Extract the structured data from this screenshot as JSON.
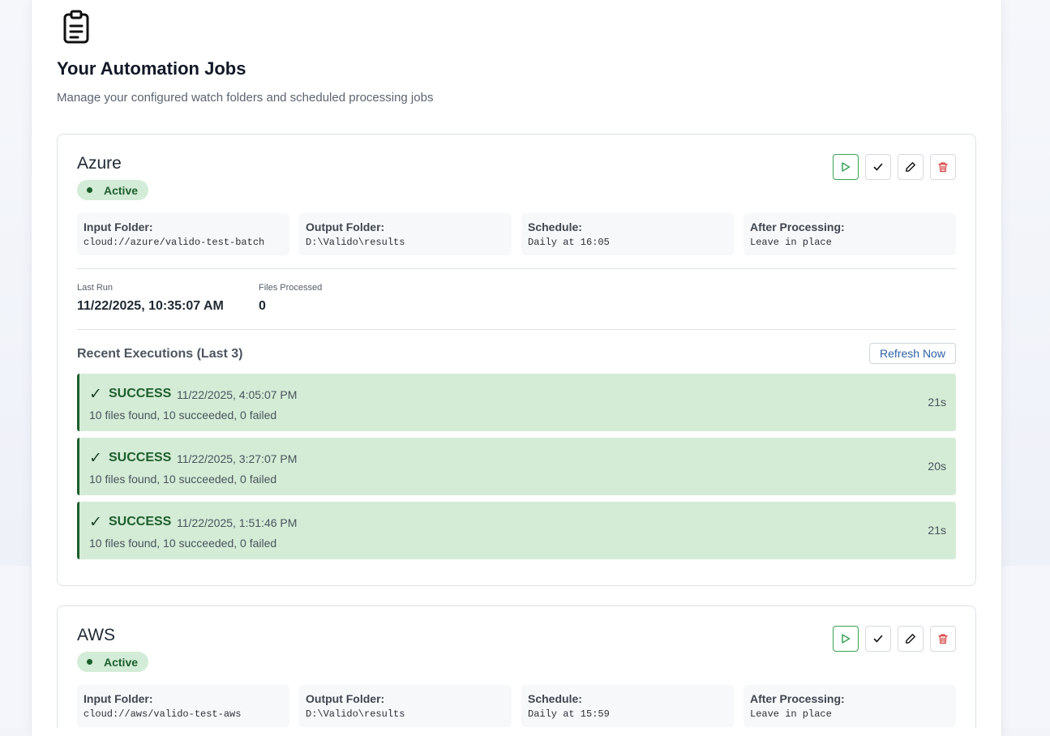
{
  "header": {
    "icon": "clipboard-icon",
    "title": "Your Automation Jobs",
    "subtitle": "Manage your configured watch folders and scheduled processing jobs"
  },
  "actions": {
    "run_icon": "play-icon",
    "validate_icon": "check-icon",
    "edit_icon": "pencil-icon",
    "delete_icon": "trash-icon"
  },
  "colors": {
    "success_bg": "#d4ecd6",
    "success_text": "#1c5e2c",
    "link": "#2d62a8",
    "delete": "#d33a3a",
    "run": "#3aa356"
  },
  "jobs": [
    {
      "name": "Azure",
      "status": "Active",
      "fields": [
        {
          "label": "Input Folder:",
          "value": "cloud://azure/valido-test-batch"
        },
        {
          "label": "Output Folder:",
          "value": "D:\\Valido\\results"
        },
        {
          "label": "Schedule:",
          "value": "Daily at 16:05"
        },
        {
          "label": "After Processing:",
          "value": "Leave in place"
        }
      ],
      "last_run_label": "Last Run",
      "last_run": "11/22/2025, 10:35:07 AM",
      "files_processed_label": "Files Processed",
      "files_processed": "0",
      "recent_title": "Recent Executions (Last 3)",
      "refresh_label": "Refresh Now",
      "executions": [
        {
          "check": "✓",
          "status": "SUCCESS",
          "time": "11/22/2025, 4:05:07 PM",
          "summary": "10 files found, 10 succeeded, 0 failed",
          "duration": "21s"
        },
        {
          "check": "✓",
          "status": "SUCCESS",
          "time": "11/22/2025, 3:27:07 PM",
          "summary": "10 files found, 10 succeeded, 0 failed",
          "duration": "20s"
        },
        {
          "check": "✓",
          "status": "SUCCESS",
          "time": "11/22/2025, 1:51:46 PM",
          "summary": "10 files found, 10 succeeded, 0 failed",
          "duration": "21s"
        }
      ]
    },
    {
      "name": "AWS",
      "status": "Active",
      "fields": [
        {
          "label": "Input Folder:",
          "value": "cloud://aws/valido-test-aws"
        },
        {
          "label": "Output Folder:",
          "value": "D:\\Valido\\results"
        },
        {
          "label": "Schedule:",
          "value": "Daily at 15:59"
        },
        {
          "label": "After Processing:",
          "value": "Leave in place"
        }
      ]
    }
  ]
}
